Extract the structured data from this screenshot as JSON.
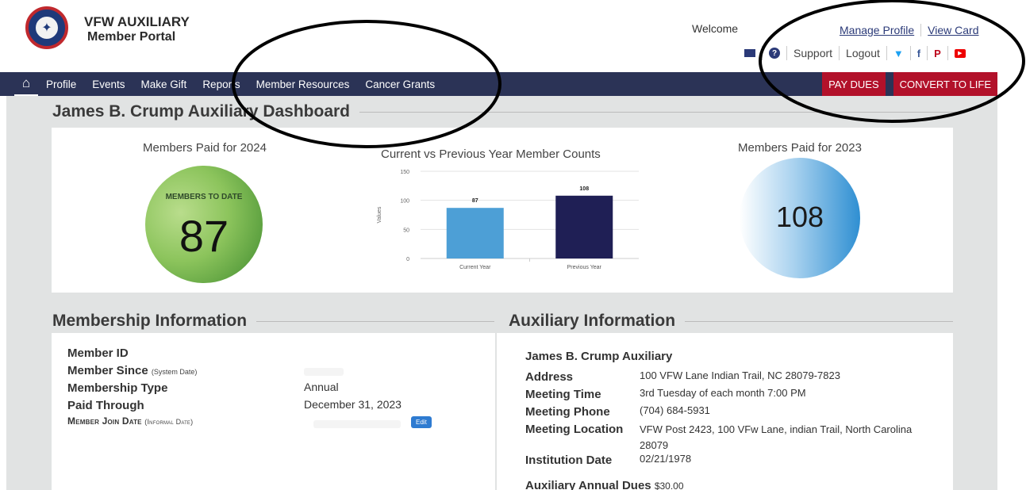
{
  "header": {
    "brand_line1": "VFW AUXILIARY",
    "brand_line2": "Member Portal",
    "welcome": "Welcome",
    "manage_profile": "Manage Profile",
    "view_card": "View Card",
    "support": "Support",
    "logout": "Logout"
  },
  "nav": {
    "items": [
      "Profile",
      "Events",
      "Make Gift",
      "Reports",
      "Member Resources",
      "Cancer Grants"
    ],
    "pay_dues": "PAY DUES",
    "convert": "CONVERT TO LIFE"
  },
  "dashboard": {
    "title": "James B. Crump Auxiliary Dashboard",
    "paid_current_title": "Members Paid for 2024",
    "members_to_date": "MEMBERS TO DATE",
    "paid_current_value": "87",
    "paid_prev_title": "Members Paid for 2023",
    "paid_prev_value": "108"
  },
  "chart_data": {
    "type": "bar",
    "title": "Current vs Previous Year Member Counts",
    "categories": [
      "Current Year",
      "Previous Year"
    ],
    "values": [
      87,
      108
    ],
    "ylabel": "Values",
    "ylim": [
      0,
      150
    ],
    "yticks": [
      0,
      50,
      100,
      150
    ],
    "colors": [
      "#4d9fd6",
      "#1f1f55"
    ],
    "grid": true
  },
  "membership": {
    "title": "Membership Information",
    "member_id_label": "Member ID",
    "member_since_label": "Member Since",
    "member_since_note": "(System Date)",
    "membership_type_label": "Membership Type",
    "membership_type_value": "Annual",
    "paid_through_label": "Paid Through",
    "paid_through_value": "December 31, 2023",
    "join_date_label": "Member Join Date",
    "join_date_note": "(Informal Date)",
    "edit_label": "Edit"
  },
  "auxiliary": {
    "title": "Auxiliary Information",
    "name": "James B. Crump Auxiliary",
    "address_label": "Address",
    "address_value": "100 VFW Lane Indian Trail, NC 28079-7823",
    "meeting_time_label": "Meeting Time",
    "meeting_time_value": "3rd Tuesday of each month 7:00 PM",
    "meeting_phone_label": "Meeting Phone",
    "meeting_phone_value": "(704) 684-5931",
    "meeting_location_label": "Meeting Location",
    "meeting_location_value": "VFW Post 2423, 100 VFw Lane, indian Trail, North Carolina 28079",
    "institution_date_label": "Institution Date",
    "institution_date_value": "02/21/1978",
    "annual_dues_label": "Auxiliary Annual Dues",
    "annual_dues_value": "$30.00"
  }
}
